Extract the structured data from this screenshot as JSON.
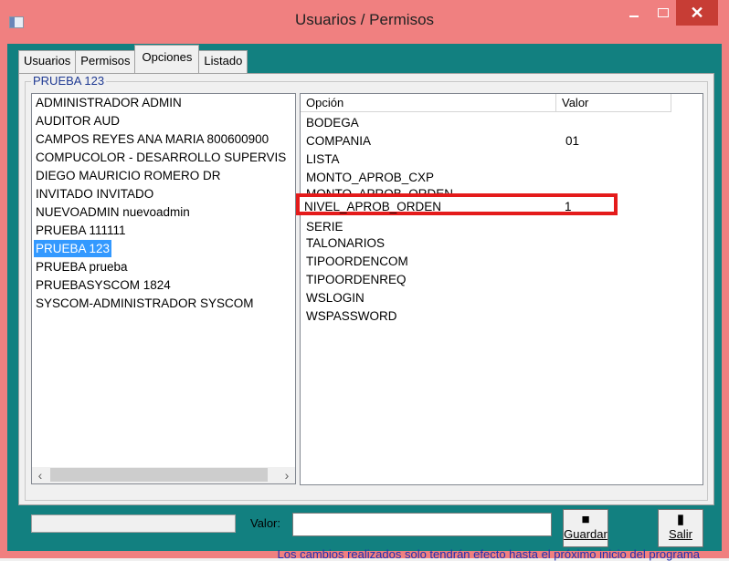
{
  "window": {
    "title": "Usuarios / Permisos"
  },
  "tabs": [
    "Usuarios",
    "Permisos",
    "Opciones",
    "Listado"
  ],
  "group_label": "PRUEBA 123",
  "users": [
    "ADMINISTRADOR ADMIN",
    "AUDITOR AUD",
    "CAMPOS REYES ANA MARIA 800600900",
    "COMPUCOLOR - DESARROLLO SUPERVIS",
    "DIEGO MAURICIO ROMERO DR",
    "INVITADO INVITADO",
    "NUEVOADMIN nuevoadmin",
    "PRUEBA 111111",
    "PRUEBA 123",
    "PRUEBA prueba",
    "PRUEBASYSCOM 1824",
    "SYSCOM-ADMINISTRADOR SYSCOM"
  ],
  "selected_user": "PRUEBA 123",
  "options_table": {
    "headers": [
      "Opción",
      "Valor"
    ],
    "rows": [
      {
        "opcion": "BODEGA",
        "valor": ""
      },
      {
        "opcion": "COMPANIA",
        "valor": "01"
      },
      {
        "opcion": "LISTA",
        "valor": ""
      },
      {
        "opcion": "MONTO_APROB_CXP",
        "valor": ""
      },
      {
        "opcion": "MONTO_APROB_ORDEN",
        "valor": ""
      },
      {
        "opcion": "NIVEL_APROB_ORDEN",
        "valor": "1"
      },
      {
        "opcion": "SERIE",
        "valor": ""
      },
      {
        "opcion": "TALONARIOS",
        "valor": ""
      },
      {
        "opcion": "TIPOORDENCOM",
        "valor": ""
      },
      {
        "opcion": "TIPOORDENREQ",
        "valor": ""
      },
      {
        "opcion": "WSLOGIN",
        "valor": ""
      },
      {
        "opcion": "WSPASSWORD",
        "valor": ""
      }
    ]
  },
  "bottom": {
    "valor_label": "Valor:",
    "valor_value": "",
    "guardar_label": "Guardar",
    "salir_label": "Salir",
    "note": "Los cambios realizados solo tendrán efecto hasta el próximo inicio del programa"
  },
  "icons": {
    "guardar": "floppy-disk-icon",
    "salir": "exit-door-icon"
  },
  "colors": {
    "title_bar": "#f08080",
    "client": "#128080",
    "selection": "#3399ff",
    "highlight_box": "#e41b1b",
    "note_text": "#1f2fb0"
  }
}
